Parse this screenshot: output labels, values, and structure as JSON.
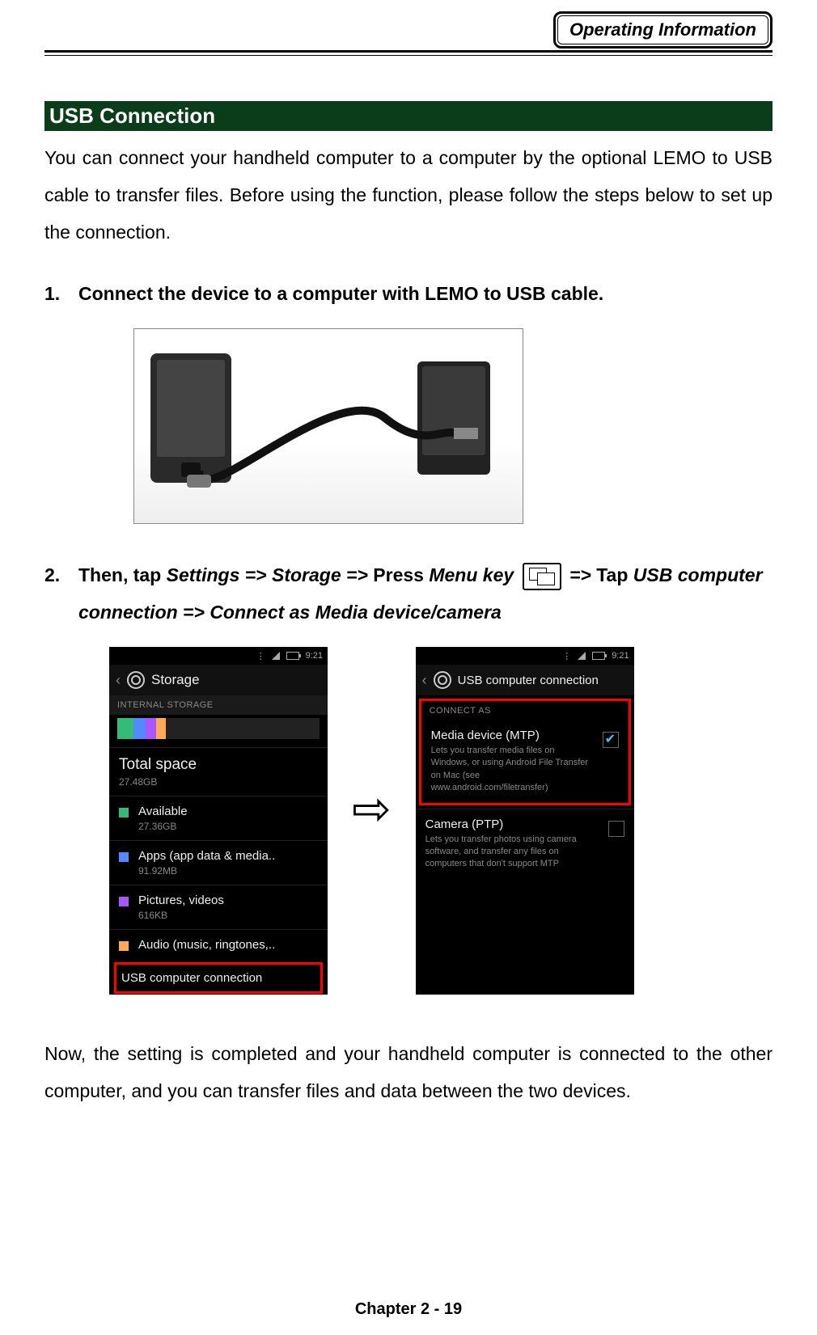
{
  "header_tab": "Operating Information",
  "section_title": " USB Connection",
  "intro": "You can connect your handheld computer to a computer by the optional LEMO to USB cable to transfer files. Before using the function, please follow the steps below to set up the connection.",
  "step1_num": "1.",
  "step1_text": "Connect the device to a computer with LEMO to USB cable.",
  "step2_num": "2.",
  "step2_pre": "Then, tap ",
  "step2_it1": "Settings => Storage => ",
  "step2_mid1": "Press ",
  "step2_it2": "Menu key",
  "step2_mid2": " => ",
  "step2_mid3": "Tap ",
  "step2_it3": "USB computer connection => Connect as Media device/camera",
  "status_time": "9:21",
  "screen1": {
    "title": "Storage",
    "section": "INTERNAL STORAGE",
    "total_label": "Total space",
    "total_value": "27.48GB",
    "rows": [
      {
        "label": "Available",
        "sub": "27.36GB"
      },
      {
        "label": "Apps (app data & media..",
        "sub": "91.92MB"
      },
      {
        "label": "Pictures, videos",
        "sub": "616KB"
      },
      {
        "label": "Audio (music, ringtones,..",
        "sub": ""
      }
    ],
    "highlight": "USB computer connection"
  },
  "screen2": {
    "title": "USB computer connection",
    "section": "CONNECT AS",
    "opt1_label": "Media device (MTP)",
    "opt1_sub": "Lets you transfer media files on Windows, or using Android File Transfer on Mac (see www.android.com/filetransfer)",
    "opt2_label": "Camera (PTP)",
    "opt2_sub": "Lets you transfer photos using camera software, and transfer any files on computers that don't support MTP"
  },
  "closing": "Now, the setting is completed and your handheld computer is connected to the other computer, and you can transfer files and data between the two devices.",
  "footer": "Chapter 2 - 19"
}
